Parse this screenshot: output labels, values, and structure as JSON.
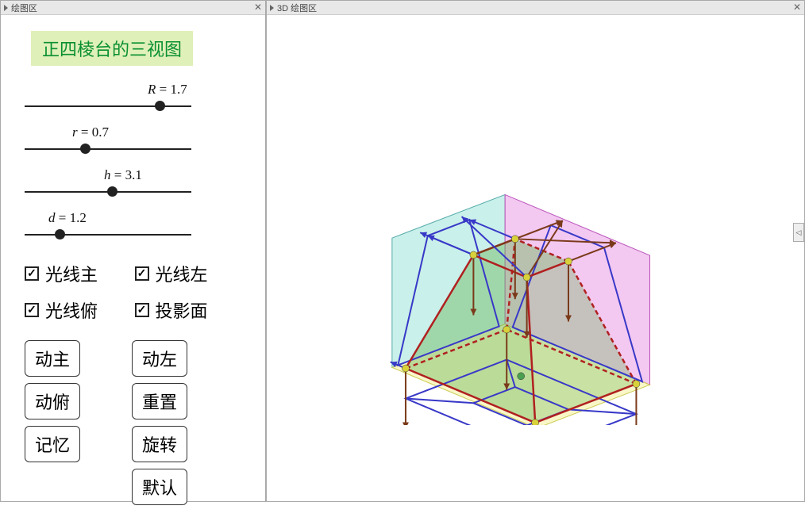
{
  "leftPanel": {
    "title": "绘图区",
    "mainTitle": "正四棱台的三视图",
    "sliders": [
      {
        "label": "R",
        "value": "1.7",
        "pos": 82,
        "labelLeft": 155
      },
      {
        "label": "r",
        "value": "0.7",
        "pos": 35,
        "labelLeft": 60
      },
      {
        "label": "h",
        "value": "3.1",
        "pos": 52,
        "labelLeft": 100
      },
      {
        "label": "d",
        "value": "1.2",
        "pos": 19,
        "labelLeft": 30
      }
    ],
    "checkboxes": [
      {
        "label": "光线主",
        "checked": true
      },
      {
        "label": "光线左",
        "checked": true
      },
      {
        "label": "光线俯",
        "checked": true
      },
      {
        "label": "投影面",
        "checked": true
      }
    ],
    "buttons": {
      "r1c1": "动主",
      "r1c2": "动左",
      "r2c1": "动俯",
      "r2c2": "重置",
      "r3c1": "记忆",
      "r3c2": "旋转",
      "r4c2": "默认"
    }
  },
  "rightPanel": {
    "title": "3D 绘图区"
  },
  "scene": {
    "planes": {
      "back": "#9de3d9",
      "right": "#e99ae6",
      "bottom": "#f4f19a"
    },
    "frustum": {
      "edgeColor": "#b02020",
      "fillColor": "#6fb85d"
    },
    "projectionColor": "#3838c8",
    "rayColor": "#7a3a1a"
  }
}
